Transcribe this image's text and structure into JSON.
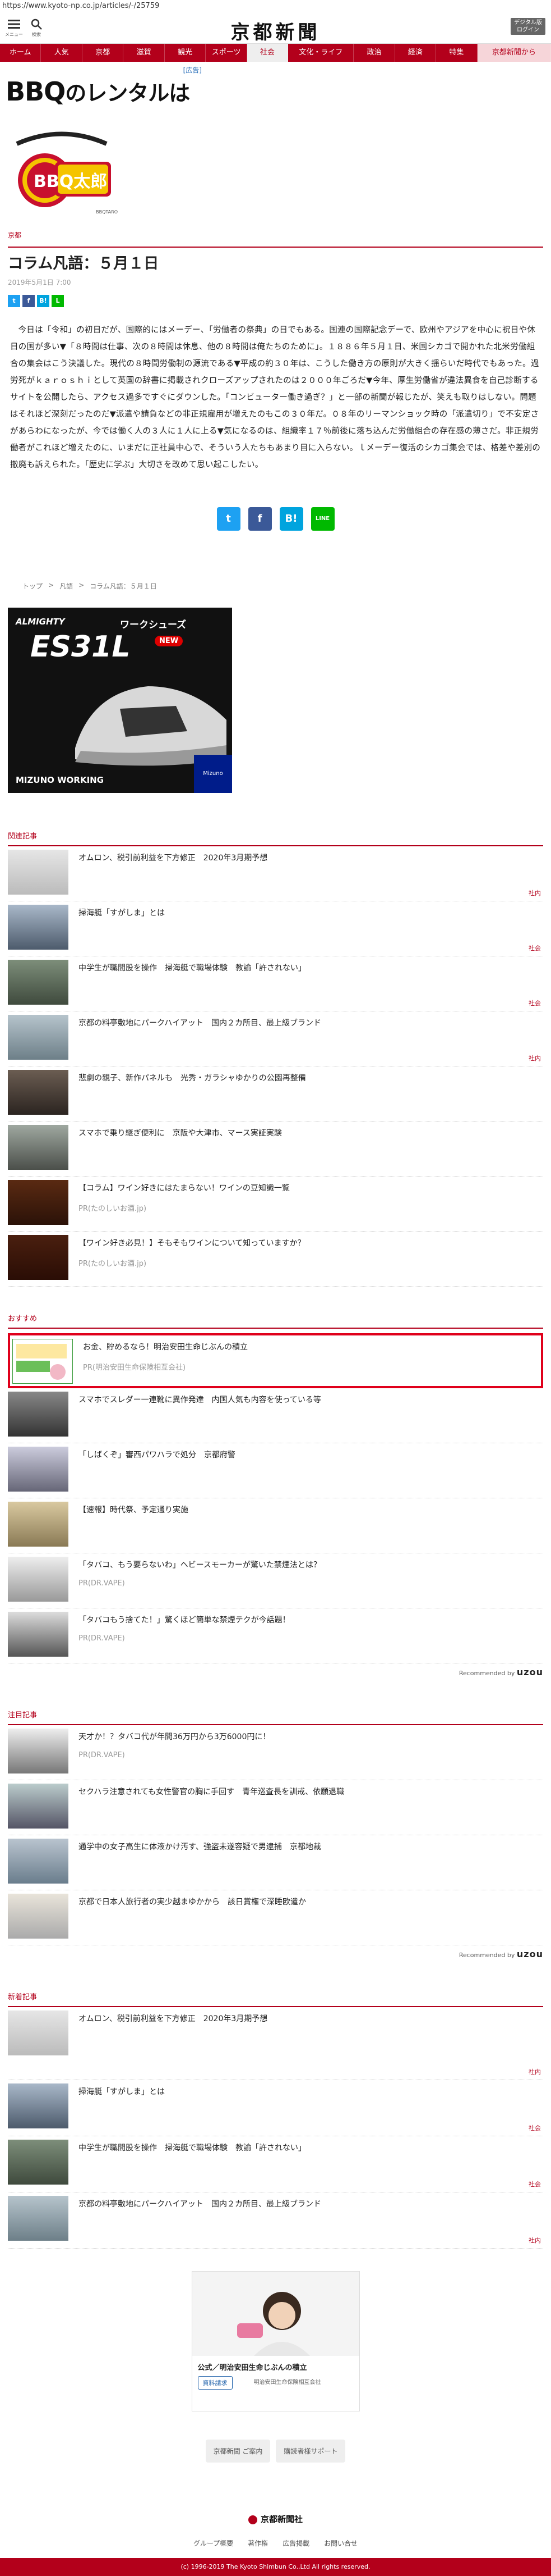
{
  "browser": {
    "url": "https://www.kyoto-np.co.jp/articles/-/25759"
  },
  "header": {
    "menu_label": "メニュー",
    "search_label": "検索",
    "logo_text": "京都新聞",
    "digital_button_line1": "デジタル版",
    "digital_button_line2": "ログイン"
  },
  "nav": {
    "items": [
      "ホーム",
      "人気",
      "京都",
      "滋賀",
      "観光",
      "スポーツ",
      "社会",
      "文化・ライフ",
      "政治",
      "経済",
      "特集",
      "京都新聞から"
    ],
    "active_index": 6
  },
  "top_ad": {
    "ad_label": "[広告]",
    "headline_main": "BBQ",
    "headline_rest": "のレンタルは",
    "logo_text": "BBQ太郎",
    "logo_sub": "BBQTARO"
  },
  "article": {
    "section": "京都",
    "title": "コラム凡語：５月１日",
    "date": "2019年5月1日 7:00",
    "body": "今日は「令和」の初日だが、国際的にはメーデー、「労働者の祭典」の日でもある。国連の国際記念デーで、欧州やアジアを中心に祝日や休日の国が多い▼「８時間は仕事、次の８時間は休息、他の８時間は俺たちのために」。１８８６年５月１日、米国シカゴで開かれた北米労働組合の集会はこう決議した。現代の８時間労働制の源流である▼平成の約３０年は、こうした働き方の原則が大きく揺らいだ時代でもあった。過労死がｋａｒｏｓｈｉとして英国の辞書に掲載されクローズアップされたのは２０００年ごろだ▼今年、厚生労働省が違法異食を自己診断するサイトを公開したら、アクセス過多ですぐにダウンした。「コンビューター働き過ぎ？」と一部の新聞が報じたが、笑えも取りはしない。問題はそれほど深刻だったのだ▼派遣や請負などの非正規雇用が増えたのもこの３０年だ。０８年のリーマンショック時の「派遣切り」で不安定さがあらわになったが、今では働く人の３人に１人に上る▼気になるのは、組織率１７％前後に落ち込んだ労働組合の存在感の薄さだ。非正規労働者がこれほど増えたのに、いまだに正社員中心で、そういう人たちもあまり目に入らない。ｌメーデー復活のシカゴ集会では、格差や差別の撤廃も訴えられた。「歴史に学ぶ」大切さを改めて思い起こしたい。"
  },
  "share": {
    "small": [
      "twitter",
      "facebook",
      "hatena",
      "line"
    ],
    "big": [
      "twitter",
      "facebook",
      "hatena",
      "line"
    ],
    "small_glyphs": [
      "t",
      "f",
      "B!",
      "L"
    ],
    "big_glyphs": [
      "t",
      "f",
      "B!",
      "LINE"
    ]
  },
  "breadcrumb": [
    "トップ",
    ">",
    "凡語",
    ">",
    "コラム凡語：５月１日"
  ],
  "shoe_ad": {
    "brand_top": "ALMIGHTY",
    "series": "ワークシューズ",
    "model": "ES31L",
    "badge": "NEW",
    "footer": "MIZUNO WORKING",
    "maker": "Mizuno"
  },
  "related": {
    "title": "関連記事",
    "items": [
      {
        "text": "オムロン、税引前利益を下方修正　2020年3月期予想",
        "cat": "社内"
      },
      {
        "text": "掃海艇「すがしま」とは",
        "cat": "社会"
      },
      {
        "text": "中学生が職間股を操作　掃海艇で職場体験　教諭「許されない」",
        "cat": "社会"
      },
      {
        "text": "京都の料亭敷地にパークハイアット　国内２カ所目、最上級ブランド",
        "cat": "社内"
      },
      {
        "text": "悲劇の親子、新作パネルも　光秀・ガラシャゆかりの公園再整備",
        "cat": ""
      },
      {
        "text": "スマホで乗り継ぎ便利に　京阪や大津市、マース実証実験",
        "cat": ""
      },
      {
        "text": "【コラム】ワイン好きにはたまらない！ワインの豆知識一覧",
        "pr": "PR(たのしいお酒.jp)"
      },
      {
        "text": "【ワイン好き必見！】そもそもワインについて知っていますか？",
        "pr": "PR(たのしいお酒.jp)"
      }
    ]
  },
  "recommend": {
    "title": "おすすめ",
    "items": [
      {
        "text": "お金、貯めるなら！明治安田生命じぶんの積立",
        "pr": "PR(明治安田生命保険相互会社)",
        "highlight": true
      },
      {
        "text": "スマホでスレダー一連靴に異作発達　内国人気も内容を使っている等"
      },
      {
        "text": "「しばくぞ」審西パワハラで処分　京都府警"
      },
      {
        "text": "【速報】時代祭、予定通り実施"
      },
      {
        "text": "「タバコ、もう要らないわ」ヘビースモーカーが驚いた禁煙法とは？",
        "pr": "PR(DR.VAPE)"
      },
      {
        "text": "「タバコもう捨てた！」驚くほど簡単な禁煙テクが今話題！",
        "pr": "PR(DR.VAPE)"
      }
    ],
    "recommended_by": "Recommended by",
    "recommended_brand": "uzou"
  },
  "attention": {
    "title": "注目記事",
    "items": [
      {
        "text": "天才か！？タバコ代が年間36万円から3万6000円に！",
        "pr": "PR(DR.VAPE)"
      },
      {
        "text": "セクハラ注意されても女性警官の胸に手回す　青年巡査長を訓戒、依願退職"
      },
      {
        "text": "通学中の女子高生に体液かけ汚す、強盗未遂容疑で男逮捕　京都地裁"
      },
      {
        "text": "京都で日本人旅行者の実少越まゆかから　該日賞権で深睡欧遣か"
      }
    ],
    "recommended_by": "Recommended by",
    "recommended_brand": "uzou"
  },
  "latest": {
    "title": "新着記事",
    "items": [
      {
        "text": "オムロン、税引前利益を下方修正　2020年3月期予想",
        "cat": "社内"
      },
      {
        "text": "掃海艇「すがしま」とは",
        "cat": "社会"
      },
      {
        "text": "中学生が職間股を操作　掃海艇で職場体験　教諭「許されない」",
        "cat": "社会"
      },
      {
        "text": "京都の料亭敷地にパークハイアット　国内２カ所目、最上級ブランド",
        "cat": "社内"
      }
    ]
  },
  "bottom_ad": {
    "headline": "公式／明治安田生命じぶんの積立",
    "button": "資料請求",
    "sponsor": "明治安田生命保険相互会社",
    "adchoice": "i"
  },
  "footer": {
    "links": [
      "京都新聞 ご案内",
      "購読者様サポート"
    ],
    "logo": "京都新聞社",
    "nav": [
      "グループ概要",
      "著作権",
      "広告掲載",
      "お問い合せ"
    ],
    "copyright": "(c) 1996-2019 The Kyoto Shimbun Co.,Ltd All rights reserved."
  },
  "colors": {
    "brand": "#b3001b",
    "twitter": "#1da1f2",
    "facebook": "#3b5998",
    "hatena": "#00a4de",
    "line": "#00b900"
  }
}
